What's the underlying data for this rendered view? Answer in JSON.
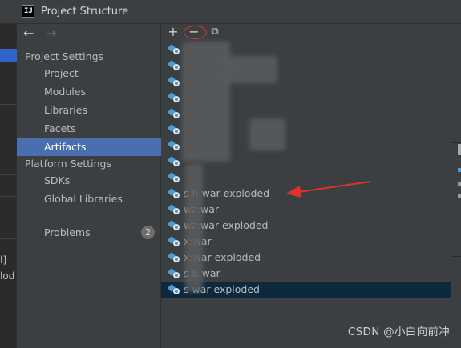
{
  "window": {
    "title": "Project Structure",
    "app_icon_label": "IJ"
  },
  "nav": {
    "back_icon": "arrow-left-icon",
    "forward_icon": "arrow-right-icon",
    "back_glyph": "←",
    "forward_glyph": "→"
  },
  "sidebar": {
    "project_settings_header": "Project Settings",
    "project_settings_items": [
      {
        "label": "Project"
      },
      {
        "label": "Modules"
      },
      {
        "label": "Libraries"
      },
      {
        "label": "Facets"
      },
      {
        "label": "Artifacts",
        "selected": true
      }
    ],
    "platform_settings_header": "Platform Settings",
    "platform_settings_items": [
      {
        "label": "SDKs"
      },
      {
        "label": "Global Libraries"
      }
    ],
    "problems": {
      "label": "Problems",
      "count": "2"
    }
  },
  "toolbar": {
    "add_glyph": "+",
    "remove_glyph": "−",
    "copy_glyph": "⧉"
  },
  "artifacts": [
    {
      "label": ""
    },
    {
      "label": ""
    },
    {
      "label": ""
    },
    {
      "label": ""
    },
    {
      "label": ""
    },
    {
      "label": ""
    },
    {
      "label": ""
    },
    {
      "label": ""
    },
    {
      "label": ""
    },
    {
      "label": "s h:war exploded"
    },
    {
      "label": "  wz:war"
    },
    {
      "label": "  wz:war exploded"
    },
    {
      "label": "  x:war"
    },
    {
      "label": "  x:war exploded"
    },
    {
      "label": "s  b:war"
    },
    {
      "label": "s  war exploded",
      "selected": true
    }
  ],
  "background_fragments": {
    "left_line1": "l]",
    "left_line2": "lod"
  },
  "watermark": "CSDN @小白向前冲",
  "colors": {
    "selection_sidebar": "#4b6eaf",
    "selection_list": "#0d293e",
    "annotation_red": "#e0322c",
    "background": "#3c3f41"
  }
}
